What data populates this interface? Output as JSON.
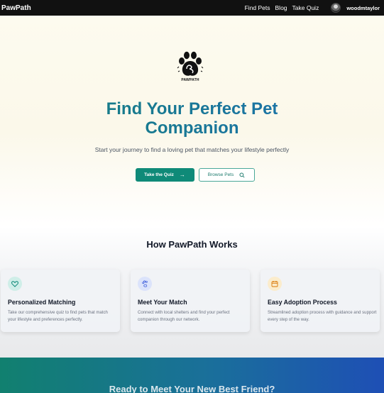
{
  "nav": {
    "brand": "PawPath",
    "links": [
      "Find Pets",
      "Blog",
      "Take Quiz"
    ],
    "username": "woodmtaylor"
  },
  "hero": {
    "logo_text": "PAWPATH",
    "title_line1": "Find Your Perfect Pet",
    "title_line2": "Companion",
    "subtitle": "Start your journey to find a loving pet that matches your lifestyle perfectly",
    "primary_button": "Take the Quiz",
    "secondary_button": "Browse Pets"
  },
  "how": {
    "title": "How PawPath Works",
    "cards": [
      {
        "icon": "heart-icon",
        "title": "Personalized Matching",
        "desc": "Take our comprehensive quiz to find pets that match your lifestyle and preferences perfectly.",
        "color": "#0f8a78"
      },
      {
        "icon": "paw-icon",
        "title": "Meet Your Match",
        "desc": "Connect with local shelters and find your perfect companion through our network.",
        "color": "#3b5bdb"
      },
      {
        "icon": "calendar-icon",
        "title": "Easy Adoption Process",
        "desc": "Streamlined adoption process with guidance and support every step of the way.",
        "color": "#d97706"
      }
    ]
  },
  "cta": {
    "title": "Ready to Meet Your New Best Friend?"
  },
  "colors": {
    "accent": "#0f8a78",
    "title_gradient_start": "#14807a",
    "title_gradient_end": "#1e6fb4",
    "topbar": "#111111"
  }
}
